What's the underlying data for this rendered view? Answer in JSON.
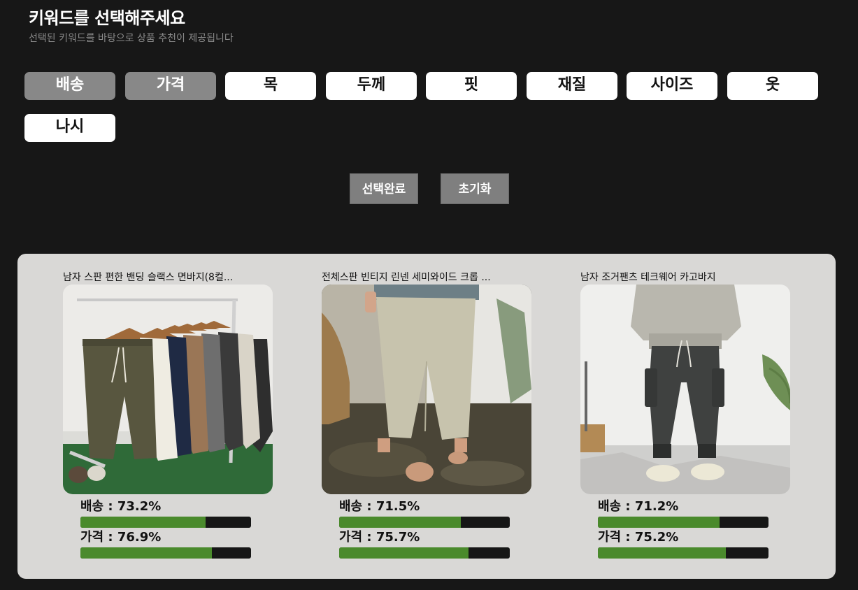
{
  "header": {
    "title": "키워드를 선택해주세요",
    "subtitle": "선택된 키워드를 바탕으로 상품 추천이 제공됩니다"
  },
  "keywords": [
    {
      "label": "배송",
      "selected": true
    },
    {
      "label": "가격",
      "selected": true
    },
    {
      "label": "목",
      "selected": false
    },
    {
      "label": "두께",
      "selected": false
    },
    {
      "label": "핏",
      "selected": false
    },
    {
      "label": "재질",
      "selected": false
    },
    {
      "label": "사이즈",
      "selected": false
    },
    {
      "label": "옷",
      "selected": false
    },
    {
      "label": "나시",
      "selected": false
    }
  ],
  "actions": {
    "confirm_label": "선택완료",
    "reset_label": "초기화"
  },
  "products": [
    {
      "title": "남자 스판 편한 밴딩 슬랙스 면바지(8컬...",
      "metrics": [
        {
          "label": "배송 : 73.2%",
          "value": 0.732
        },
        {
          "label": "가격 : 76.9%",
          "value": 0.769
        }
      ]
    },
    {
      "title": "전체스판 빈티지 린넨 세미와이드 크롭 ...",
      "metrics": [
        {
          "label": "배송 : 71.5%",
          "value": 0.715
        },
        {
          "label": "가격 : 75.7%",
          "value": 0.757
        }
      ]
    },
    {
      "title": "남자 조거팬츠 테크웨어 카고바지",
      "metrics": [
        {
          "label": "배송 : 71.2%",
          "value": 0.712
        },
        {
          "label": "가격 : 75.2%",
          "value": 0.752
        }
      ]
    }
  ],
  "colors": {
    "background": "#171717",
    "panel": "#d9d8d6",
    "selected_keyword": "#888888",
    "bar_fill": "#4a8a2c",
    "bar_track": "#161616"
  }
}
